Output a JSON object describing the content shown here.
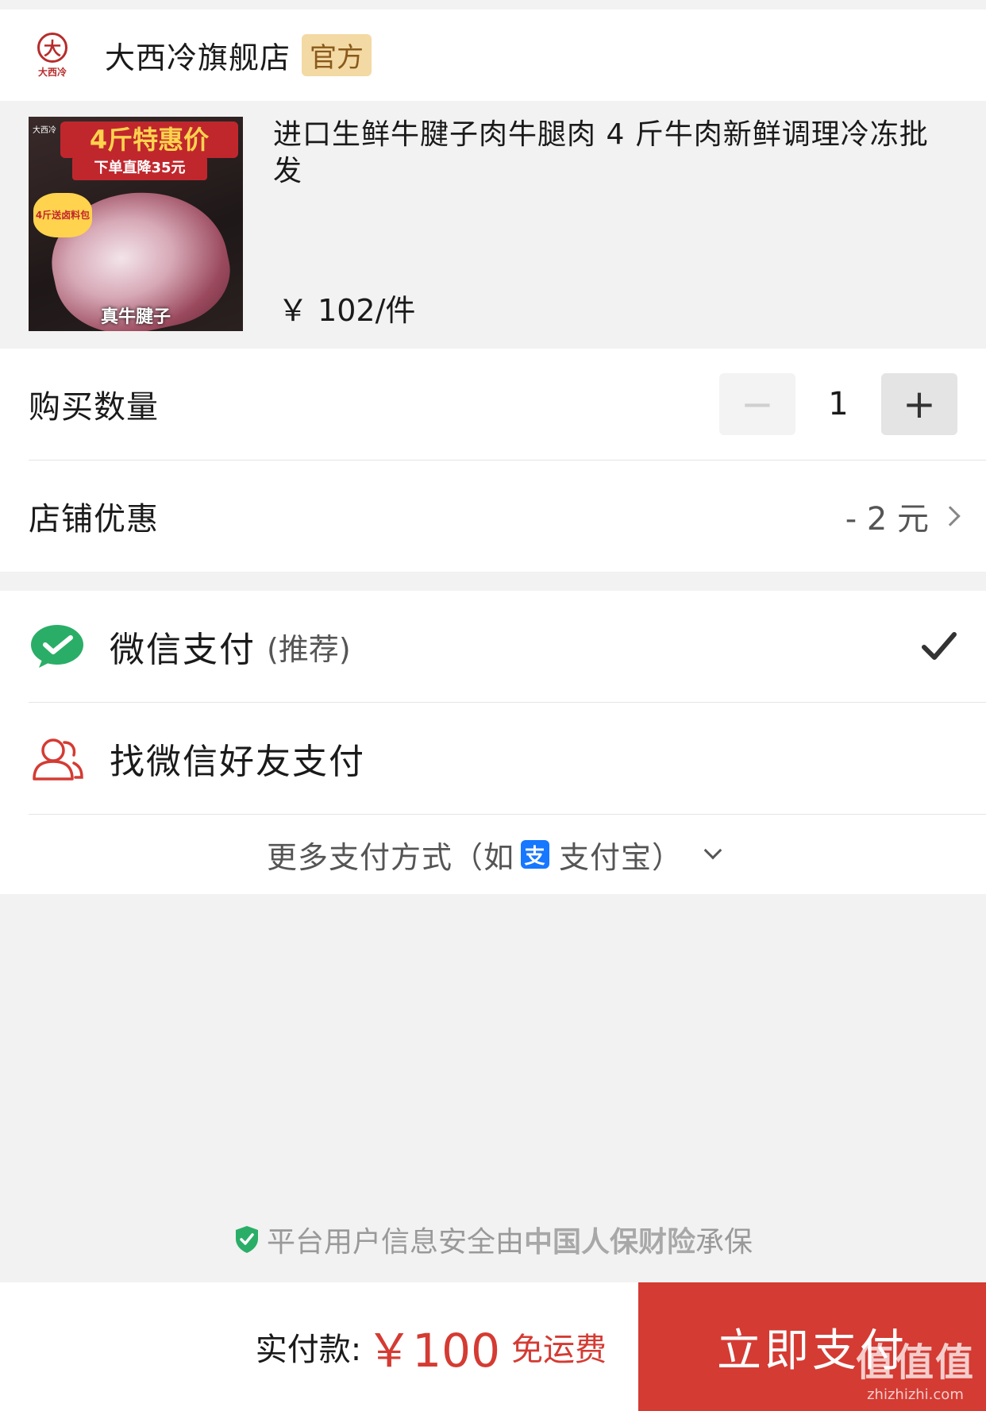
{
  "shop": {
    "logo_mark": "大",
    "logo_text": "大西冷",
    "name": "大西冷旗舰店",
    "badge": "官方"
  },
  "product": {
    "thumb": {
      "headline": "4斤特惠价",
      "subline": "下单直降35元",
      "sticker": "4斤送卤料包",
      "footer": "真牛腱子",
      "logo": "大西冷"
    },
    "title": "进口生鲜牛腱子肉牛腿肉 4 斤牛肉新鲜调理冷冻批发",
    "price": "￥ 102/件"
  },
  "quantity": {
    "label": "购买数量",
    "minus": "−",
    "value": "1",
    "plus": "+"
  },
  "discount": {
    "label": "店铺优惠",
    "value": "- 2 元"
  },
  "payment": {
    "wechat_label": "微信支付",
    "wechat_sub": "(推荐)",
    "friend_label": "找微信好友支付",
    "more_prefix": "更多支付方式（如",
    "alipay_icon": "支",
    "more_suffix": "支付宝）"
  },
  "security": {
    "prefix": "平台用户信息安全由",
    "insurer": "中国人保财险",
    "suffix": "承保"
  },
  "footer": {
    "total_label": "实付款:",
    "total_value": "￥100",
    "shipping": "免运费",
    "pay_button": "立即支付"
  },
  "watermark": {
    "big": "值值值",
    "small": "zhizhizhi.com"
  },
  "colors": {
    "accent_red": "#d43b33",
    "wechat_green": "#2aae67",
    "badge_gold": "#f3d9a4",
    "alipay_blue": "#1677ff"
  }
}
